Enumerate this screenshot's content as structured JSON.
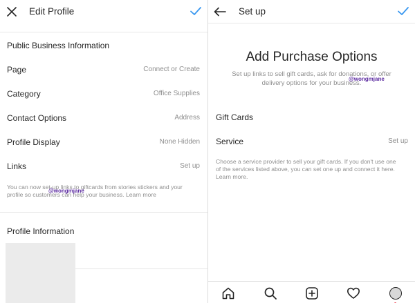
{
  "colors": {
    "accent": "#3897f0",
    "text": "#262626",
    "muted": "#8e8e8e",
    "watermark": "#5b2aa0"
  },
  "left": {
    "header": {
      "close_icon": "close-icon",
      "title": "Edit Profile",
      "confirm_icon": "check-icon"
    },
    "business_section": {
      "title": "Public Business Information",
      "rows": [
        {
          "label": "Page",
          "value": "Connect or Create"
        },
        {
          "label": "Category",
          "value": "Office Supplies"
        },
        {
          "label": "Contact Options",
          "value": "Address"
        },
        {
          "label": "Profile Display",
          "value": "None Hidden"
        },
        {
          "label": "Links",
          "value": "Set up"
        }
      ],
      "note_line1": "You can now set-up links to giftcards from stories stickers and your",
      "note_line2": "profile so customers can help your business. Learn more"
    },
    "profile_section": {
      "title": "Profile Information"
    },
    "watermark": "@wongmjane"
  },
  "right": {
    "header": {
      "back_icon": "arrow-left-icon",
      "title": "Set up",
      "confirm_icon": "check-icon"
    },
    "title": "Add Purchase Options",
    "subtitle_line1": "Set up links to sell gift cards, ask for donations, or offer",
    "subtitle_line2": "delivery options for your business.",
    "watermark": "@wongmjane",
    "rows": [
      {
        "label": "Gift Cards",
        "value": ""
      },
      {
        "label": "Service",
        "value": "Set up"
      }
    ],
    "note_line1": "Choose a service provider to sell your gift cards. If you don't use one",
    "note_line2": "of the services listed above, you can set one up and connect it here.",
    "note_line3": "Learn more.",
    "tabbar": [
      "home-icon",
      "search-icon",
      "add-post-icon",
      "heart-icon",
      "profile-avatar"
    ]
  }
}
